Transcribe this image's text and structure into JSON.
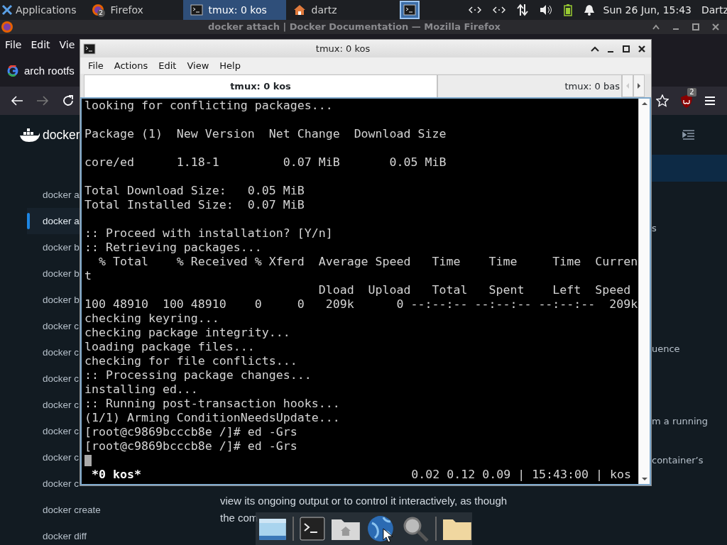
{
  "panel": {
    "applications": "Applications",
    "tasks": [
      {
        "kind": "firefox",
        "label": "Firefox",
        "badge": "2",
        "selected": false
      },
      {
        "kind": "terminal",
        "label": "tmux: 0 kos",
        "selected": true
      },
      {
        "kind": "home",
        "label": "dartz",
        "selected": false
      },
      {
        "kind": "workspace",
        "selected": true
      }
    ],
    "clock": "Sun 26 Jun, 15:43",
    "user": "Dartz"
  },
  "browser": {
    "title": "docker attach | Docker Documentation — Mozilla Firefox",
    "menu": [
      "File",
      "Edit",
      "Vie"
    ],
    "tab": "arch rootfs",
    "extension_badge": "2",
    "logo_text": "docker",
    "sidebar": [
      {
        "label": "docker a",
        "selected": false
      },
      {
        "label": "docker a",
        "selected": true
      },
      {
        "label": "docker b",
        "selected": false
      },
      {
        "label": "docker b",
        "selected": false
      },
      {
        "label": "docker b",
        "selected": false
      },
      {
        "label": "docker c",
        "selected": false
      },
      {
        "label": "docker c",
        "selected": false
      },
      {
        "label": "docker c",
        "selected": false
      },
      {
        "label": "docker c",
        "selected": false
      },
      {
        "label": "docker c",
        "selected": false
      },
      {
        "label": "docker c",
        "selected": false
      },
      {
        "label": "docker c",
        "selected": false
      },
      {
        "label": "docker create",
        "selected": false
      },
      {
        "label": "docker diff",
        "selected": false
      }
    ],
    "right_fragments": [
      "s",
      "uence",
      "m a running",
      "container’s"
    ],
    "paragraph_lines": [
      "view its ongoing output or to control it interactively, as though",
      "the com"
    ]
  },
  "terminal": {
    "title": "tmux: 0 kos",
    "menu": [
      "File",
      "Actions",
      "Edit",
      "View",
      "Help"
    ],
    "tabs": [
      {
        "label": "tmux: 0 kos",
        "selected": true
      },
      {
        "label": "tmux: 0 bas",
        "selected": false
      }
    ],
    "lines": [
      {
        "kind": "text",
        "text": "looking for conflicting packages..."
      },
      {
        "kind": "blank"
      },
      {
        "kind": "text",
        "text": "Package (1)  New Version  Net Change  Download Size"
      },
      {
        "kind": "blank"
      },
      {
        "kind": "text",
        "text": "core/ed      1.18-1         0.07 MiB       0.05 MiB"
      },
      {
        "kind": "blank"
      },
      {
        "kind": "text",
        "text": "Total Download Size:   0.05 MiB"
      },
      {
        "kind": "text",
        "text": "Total Installed Size:  0.07 MiB"
      },
      {
        "kind": "blank"
      },
      {
        "kind": "text",
        "text": ":: Proceed with installation? [Y/n]"
      },
      {
        "kind": "text",
        "text": ":: Retrieving packages..."
      },
      {
        "kind": "text",
        "text": "  % Total    % Received % Xferd  Average Speed   Time    Time     Time  Curren"
      },
      {
        "kind": "text",
        "text": "t"
      },
      {
        "kind": "text",
        "text": "                                 Dload  Upload   Total   Spent    Left  Speed"
      },
      {
        "kind": "text",
        "text": "100 48910  100 48910    0     0   209k      0 --:--:-- --:--:-- --:--:--  209k"
      },
      {
        "kind": "text",
        "text": "checking keyring..."
      },
      {
        "kind": "text",
        "text": "checking package integrity..."
      },
      {
        "kind": "text",
        "text": "loading package files..."
      },
      {
        "kind": "text",
        "text": "checking for file conflicts..."
      },
      {
        "kind": "text",
        "text": ":: Processing package changes..."
      },
      {
        "kind": "text",
        "text": "installing ed..."
      },
      {
        "kind": "text",
        "text": ":: Running post-transaction hooks..."
      },
      {
        "kind": "text",
        "text": "(1/1) Arming ConditionNeedsUpdate..."
      },
      {
        "kind": "text",
        "text": "[root@c9869bcccb8e /]# ed -Grs"
      },
      {
        "kind": "text",
        "text": "[root@c9869bcccb8e /]# ed -Grs"
      },
      {
        "kind": "cursor"
      }
    ],
    "status_left": "*0 kos*",
    "status_right": "0.02 0.12 0.09 | 15:43:00 | kos"
  }
}
